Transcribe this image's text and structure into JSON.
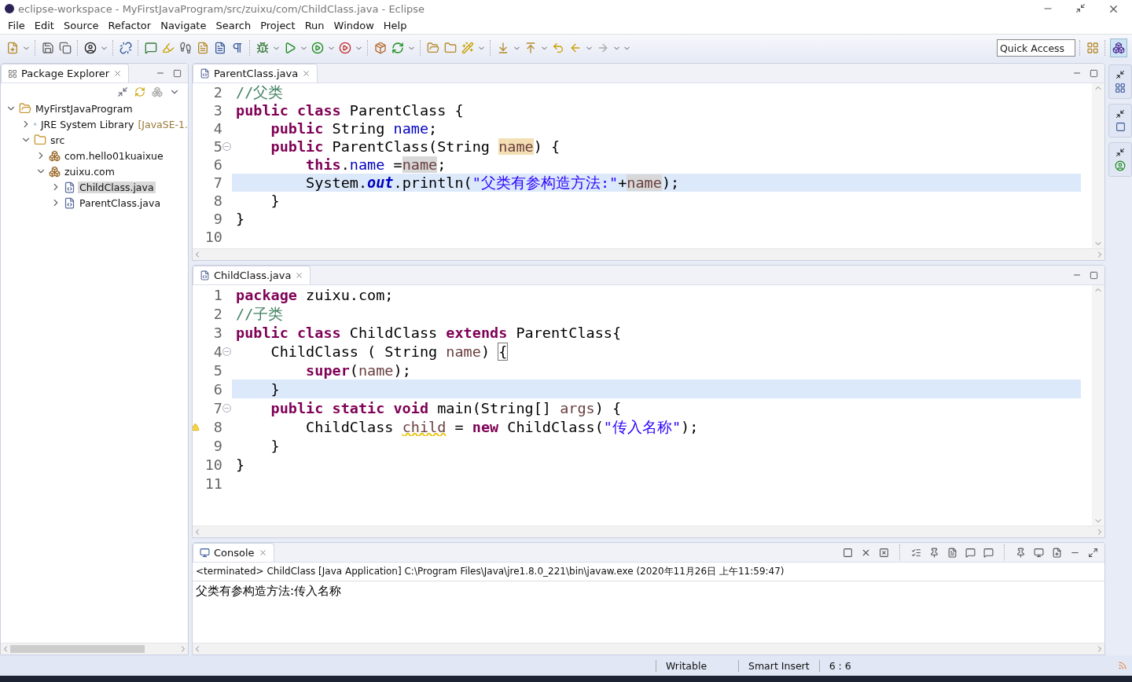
{
  "window": {
    "title": "eclipse-workspace - MyFirstJavaProgram/src/zuixu/com/ChildClass.java - Eclipse"
  },
  "menu": [
    "File",
    "Edit",
    "Source",
    "Refactor",
    "Navigate",
    "Search",
    "Project",
    "Run",
    "Window",
    "Help"
  ],
  "quick_access": {
    "placeholder": "Quick Access"
  },
  "package_explorer": {
    "title": "Package Explorer",
    "tree": [
      {
        "label": "MyFirstJavaProgram",
        "kind": "project",
        "expanded": true,
        "selected": false,
        "children": [
          {
            "label": "JRE System Library",
            "suffix": "[JavaSE-1.",
            "kind": "library",
            "expanded": false,
            "selected": false
          },
          {
            "label": "src",
            "kind": "folder",
            "expanded": true,
            "selected": false,
            "children": [
              {
                "label": "com.hello01kuaixue",
                "kind": "package",
                "expanded": false,
                "selected": false
              },
              {
                "label": "zuixu.com",
                "kind": "package",
                "expanded": true,
                "selected": false,
                "children": [
                  {
                    "label": "ChildClass.java",
                    "kind": "file",
                    "expanded": false,
                    "selected": true
                  },
                  {
                    "label": "ParentClass.java",
                    "kind": "file",
                    "expanded": false,
                    "selected": false
                  }
                ]
              }
            ]
          }
        ]
      }
    ]
  },
  "editors": [
    {
      "tab": "ParentClass.java",
      "lines": [
        {
          "number": "2",
          "current": false,
          "foldable": false,
          "warning": false,
          "tokens": [
            {
              "kind": "comment",
              "text": "//父类"
            }
          ]
        },
        {
          "number": "3",
          "current": false,
          "foldable": false,
          "warning": false,
          "tokens": [
            {
              "kind": "keyword",
              "text": "public "
            },
            {
              "kind": "keyword",
              "text": "class"
            },
            {
              "kind": "plain",
              "text": " ParentClass {"
            }
          ]
        },
        {
          "number": "4",
          "current": false,
          "foldable": false,
          "warning": false,
          "tokens": [
            {
              "kind": "keyword",
              "text": "    public"
            },
            {
              "kind": "plain",
              "text": " String "
            },
            {
              "kind": "field",
              "text": "name"
            },
            {
              "kind": "plain",
              "text": ";"
            }
          ]
        },
        {
          "number": "5",
          "current": false,
          "foldable": true,
          "warning": false,
          "tokens": [
            {
              "kind": "keyword",
              "text": "    public"
            },
            {
              "kind": "plain",
              "text": " ParentClass(String "
            },
            {
              "kind": "occurrence",
              "text": "name"
            },
            {
              "kind": "plain",
              "text": ") {"
            }
          ]
        },
        {
          "number": "6",
          "current": false,
          "foldable": false,
          "warning": false,
          "tokens": [
            {
              "kind": "keyword",
              "text": "        this"
            },
            {
              "kind": "plain",
              "text": "."
            },
            {
              "kind": "field",
              "text": "name"
            },
            {
              "kind": "plain",
              "text": " ="
            },
            {
              "kind": "read_occurrence",
              "text": "name"
            },
            {
              "kind": "plain",
              "text": ";"
            }
          ]
        },
        {
          "number": "7",
          "current": true,
          "foldable": false,
          "warning": false,
          "tokens": [
            {
              "kind": "plain",
              "text": "        System."
            },
            {
              "kind": "static_field",
              "text": "out"
            },
            {
              "kind": "plain",
              "text": ".println("
            },
            {
              "kind": "string",
              "text": "\"父类有参构造方法:\""
            },
            {
              "kind": "plain",
              "text": "+"
            },
            {
              "kind": "read_occurrence",
              "text": "name"
            },
            {
              "kind": "plain",
              "text": ");"
            }
          ]
        },
        {
          "number": "8",
          "current": false,
          "foldable": false,
          "warning": false,
          "tokens": [
            {
              "kind": "plain",
              "text": "    }"
            }
          ]
        },
        {
          "number": "9",
          "current": false,
          "foldable": false,
          "warning": false,
          "tokens": [
            {
              "kind": "plain",
              "text": "}"
            }
          ]
        },
        {
          "number": "10",
          "current": false,
          "foldable": false,
          "warning": false
        }
      ]
    },
    {
      "tab": "ChildClass.java",
      "lines": [
        {
          "number": "1",
          "current": false,
          "foldable": false,
          "warning": false,
          "tokens": [
            {
              "kind": "keyword",
              "text": "package"
            },
            {
              "kind": "plain",
              "text": " zuixu.com;"
            }
          ]
        },
        {
          "number": "2",
          "current": false,
          "foldable": false,
          "warning": false,
          "tokens": [
            {
              "kind": "comment",
              "text": "//子类"
            }
          ]
        },
        {
          "number": "3",
          "current": false,
          "foldable": false,
          "warning": false,
          "tokens": [
            {
              "kind": "keyword",
              "text": "public "
            },
            {
              "kind": "keyword",
              "text": "class"
            },
            {
              "kind": "plain",
              "text": " ChildClass "
            },
            {
              "kind": "keyword",
              "text": "extends"
            },
            {
              "kind": "plain",
              "text": " ParentClass{"
            }
          ]
        },
        {
          "number": "4",
          "current": false,
          "foldable": true,
          "warning": false,
          "tokens": [
            {
              "kind": "plain",
              "text": "    ChildClass ( String "
            },
            {
              "kind": "local",
              "text": "name"
            },
            {
              "kind": "plain",
              "text": ") "
            },
            {
              "kind": "bracket",
              "text": "{"
            }
          ]
        },
        {
          "number": "5",
          "current": false,
          "foldable": false,
          "warning": false,
          "tokens": [
            {
              "kind": "keyword",
              "text": "        super"
            },
            {
              "kind": "plain",
              "text": "("
            },
            {
              "kind": "local",
              "text": "name"
            },
            {
              "kind": "plain",
              "text": ");"
            }
          ]
        },
        {
          "number": "6",
          "current": true,
          "foldable": false,
          "warning": false,
          "tokens": [
            {
              "kind": "plain",
              "text": "    }"
            }
          ]
        },
        {
          "number": "7",
          "current": false,
          "foldable": true,
          "warning": false,
          "tokens": [
            {
              "kind": "keyword",
              "text": "    public static void"
            },
            {
              "kind": "plain",
              "text": " main(String[] "
            },
            {
              "kind": "local",
              "text": "args"
            },
            {
              "kind": "plain",
              "text": ") {"
            }
          ]
        },
        {
          "number": "8",
          "current": false,
          "foldable": false,
          "warning": true,
          "tokens": [
            {
              "kind": "plain",
              "text": "        ChildClass "
            },
            {
              "kind": "unused",
              "text": "child"
            },
            {
              "kind": "plain",
              "text": " = "
            },
            {
              "kind": "keyword",
              "text": "new"
            },
            {
              "kind": "plain",
              "text": " ChildClass("
            },
            {
              "kind": "string",
              "text": "\"传入名称\""
            },
            {
              "kind": "plain",
              "text": ");"
            }
          ]
        },
        {
          "number": "9",
          "current": false,
          "foldable": false,
          "warning": false,
          "tokens": [
            {
              "kind": "plain",
              "text": "    }"
            }
          ]
        },
        {
          "number": "10",
          "current": false,
          "foldable": false,
          "warning": false,
          "tokens": [
            {
              "kind": "plain",
              "text": "}"
            }
          ]
        },
        {
          "number": "11",
          "current": false,
          "foldable": false,
          "warning": false
        }
      ]
    }
  ],
  "console": {
    "title": "Console",
    "header": "<terminated> ChildClass [Java Application] C:\\Program Files\\Java\\jre1.8.0_221\\bin\\javaw.exe (2020年11月26日 上午11:59:47)",
    "output": "父类有参构造方法:传入名称"
  },
  "status_bar": [
    "Writable",
    "Smart Insert",
    "6 : 6"
  ]
}
